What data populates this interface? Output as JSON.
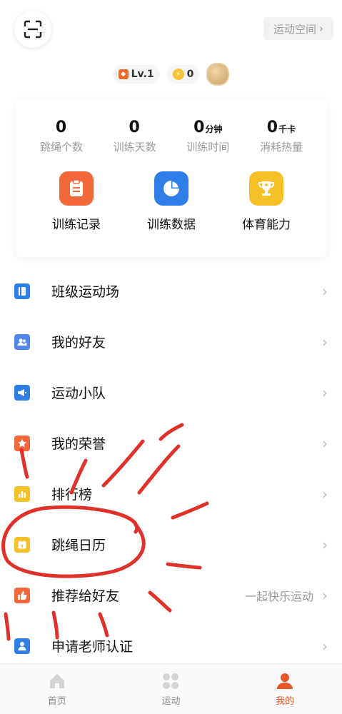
{
  "header": {
    "space_button": "运动空间",
    "space_chevron": "›"
  },
  "badges": {
    "level": "Lv.1",
    "coins": "0"
  },
  "stats": [
    {
      "value": "0",
      "unit": "",
      "label": "跳绳个数"
    },
    {
      "value": "0",
      "unit": "",
      "label": "训练天数"
    },
    {
      "value": "0",
      "unit": "分钟",
      "label": "训练时间"
    },
    {
      "value": "0",
      "unit": "千卡",
      "label": "消耗热量"
    }
  ],
  "tools": [
    {
      "label": "训练记录",
      "icon": "clipboard-icon",
      "color": "#f2683a"
    },
    {
      "label": "训练数据",
      "icon": "pie-chart-icon",
      "color": "#2f7ee8"
    },
    {
      "label": "体育能力",
      "icon": "trophy-icon",
      "color": "#f5c127"
    }
  ],
  "menu": [
    {
      "label": "班级运动场",
      "extra": "",
      "icon": "notebook-icon",
      "color": "#2f7ee8"
    },
    {
      "label": "我的好友",
      "extra": "",
      "icon": "friends-icon",
      "color": "#4f86e8"
    },
    {
      "label": "运动小队",
      "extra": "",
      "icon": "megaphone-icon",
      "color": "#2f7ee8"
    },
    {
      "label": "我的荣誉",
      "extra": "",
      "icon": "star-badge-icon",
      "color": "#f2683a"
    },
    {
      "label": "排行榜",
      "extra": "",
      "icon": "bar-chart-icon",
      "color": "#f5c127"
    },
    {
      "label": "跳绳日历",
      "extra": "",
      "icon": "calendar-icon",
      "color": "#f5c127"
    },
    {
      "label": "推荐给好友",
      "extra": "一起快乐运动",
      "icon": "thumbs-up-icon",
      "color": "#f2683a"
    },
    {
      "label": "申请老师认证",
      "extra": "",
      "icon": "teacher-icon",
      "color": "#2f7ee8"
    }
  ],
  "tabbar": [
    {
      "label": "首页",
      "active": false
    },
    {
      "label": "运动",
      "active": false
    },
    {
      "label": "我的",
      "active": true
    }
  ],
  "colors": {
    "accent": "#e8572a",
    "annotation": "#e0312a"
  }
}
